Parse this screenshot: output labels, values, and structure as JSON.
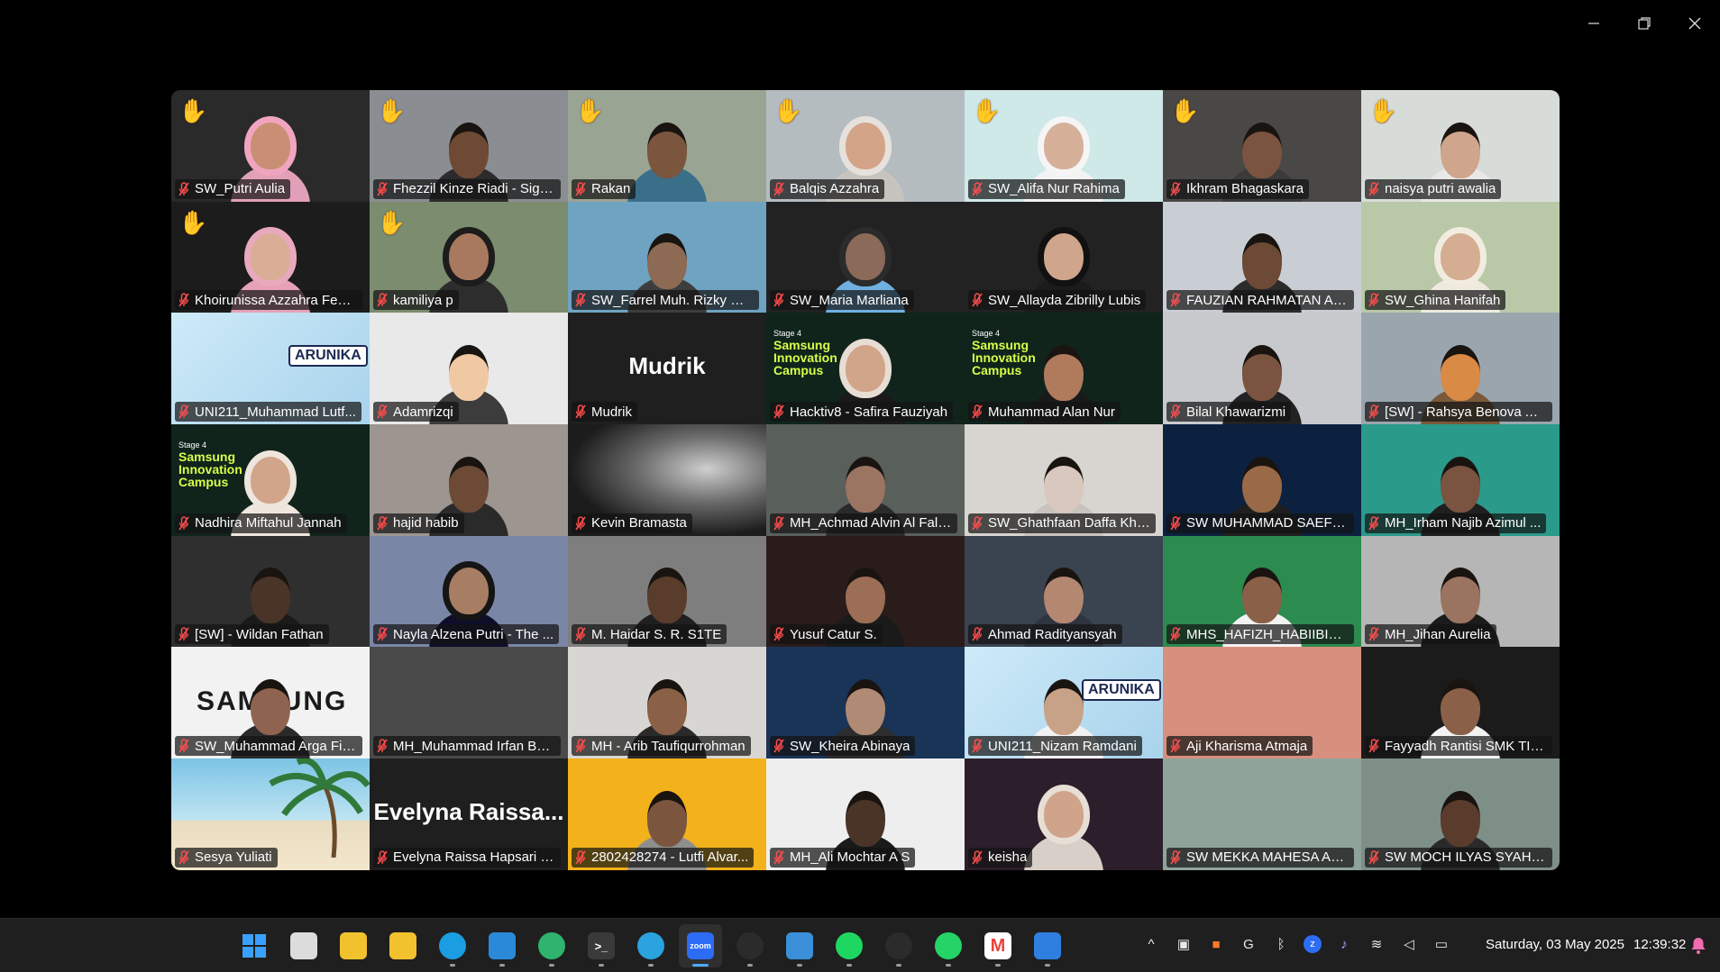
{
  "window": {
    "controls": [
      "minimize-icon",
      "restore-icon",
      "close-icon"
    ]
  },
  "participants": [
    {
      "name": "SW_Putri Aulia",
      "hand": true,
      "bg": "#2a2a2a",
      "skin": "#c98f74",
      "cloth": "#e2a0b8",
      "hijab": "#f1a4bf"
    },
    {
      "name": "Fhezzil Kinze Riadi - Sigm...",
      "hand": true,
      "bg": "#8a8d92",
      "skin": "#6e4a35",
      "cloth": "#2b2b2b"
    },
    {
      "name": "Rakan",
      "hand": true,
      "bg": "#9aa493",
      "skin": "#7b553e",
      "cloth": "#3a6f8a"
    },
    {
      "name": "Balqis Azzahra",
      "hand": true,
      "bg": "#b5bcc0",
      "skin": "#d3a488",
      "cloth": "#c7c3bf",
      "hijab": "#e6e1dc"
    },
    {
      "name": "SW_Alifa Nur Rahima",
      "hand": true,
      "bg": "#cfe8e8",
      "skin": "#d7b09a",
      "cloth": "#f3f3f3",
      "hijab": "#f5f5f5"
    },
    {
      "name": "Ikhram Bhagaskara",
      "hand": true,
      "bg": "#4a4747",
      "skin": "#7a5440",
      "cloth": "#3a3a3a"
    },
    {
      "name": "naisya putri awalia",
      "hand": true,
      "bg": "#d8dcd8",
      "skin": "#cfa58b",
      "cloth": "#e8e8e8"
    },
    {
      "name": "Khoirunissa Azzahra Febri...",
      "hand": true,
      "bg": "#1c1c1c",
      "skin": "#d9ad96",
      "cloth": "#e6a1b6",
      "hijab": "#e8a9bd"
    },
    {
      "name": "kamiliya p",
      "hand": true,
      "bg": "#7b8c6f",
      "skin": "#a8795e",
      "cloth": "#2d2d2d",
      "hijab": "#1c1c1c"
    },
    {
      "name": "SW_Farrel Muh. Rizky Wi...",
      "hand": false,
      "bg": "#6fa3c2",
      "skin": "#8d6a53",
      "cloth": "#3d3d3d"
    },
    {
      "name": "SW_Maria Marliana",
      "hand": false,
      "bg": "#222222",
      "skin": "#8b6a5a",
      "cloth": "#6fb0e0",
      "hijab": "#2b2b2b"
    },
    {
      "name": "SW_Allayda Zibrilly Lubis",
      "hand": false,
      "bg": "#222222",
      "skin": "#cfa58b",
      "cloth": "#1b1b1b",
      "hijab": "#111111"
    },
    {
      "name": "FAUZIAN RAHMATAN AN...",
      "hand": false,
      "bg": "#c9ced4",
      "skin": "#6d4a36",
      "cloth": "#2b2b2b"
    },
    {
      "name": "SW_Ghina Hanifah",
      "hand": false,
      "bg": "#b9c9a8",
      "skin": "#d4ad92",
      "cloth": "#efeae0",
      "hijab": "#f1ecdf"
    },
    {
      "name": "UNI211_Muhammad Lutf...",
      "hand": false,
      "bg": "#bfe1f3",
      "special": "arunika"
    },
    {
      "name": "Adamrizqi",
      "hand": false,
      "bg": "#e9e9e9",
      "skin": "#f0c9a4",
      "cloth": "#3c3c3c"
    },
    {
      "name": "Mudrik",
      "hand": false,
      "bg": "#1f1f1f",
      "special": "avatar",
      "big": "Mudrik"
    },
    {
      "name": "Hacktiv8 - Safira Fauziyah",
      "hand": false,
      "bg": "#10241c",
      "special": "slide",
      "active": true,
      "skin": "#d1a58a",
      "cloth": "#1a1a1a",
      "hijab": "#e7ddd3",
      "stage": "Stage 4",
      "title": "Samsung Innovation Campus"
    },
    {
      "name": "Muhammad Alan Nur",
      "hand": false,
      "bg": "#10241c",
      "special": "slide",
      "skin": "#b07b5c",
      "cloth": "#1a1a1a",
      "stage": "Stage 4",
      "title": "Samsung Innovation Campus"
    },
    {
      "name": "Bilal Khawarizmi",
      "hand": false,
      "bg": "#c7c9cc",
      "skin": "#7a5440",
      "cloth": "#222222"
    },
    {
      "name": "[SW] - Rahsya Benova Ak...",
      "hand": false,
      "bg": "#9aa5ae",
      "skin": "#d98a45",
      "cloth": "#7a5a3a"
    },
    {
      "name": "Nadhira Miftahul Jannah",
      "hand": false,
      "bg": "#10241c",
      "special": "slide",
      "skin": "#d1a58a",
      "cloth": "#efe7de",
      "hijab": "#eee5dc",
      "stage": "Stage 4",
      "title": "Samsung Innovation Campus"
    },
    {
      "name": "hajid habib",
      "hand": false,
      "bg": "#9d9690",
      "skin": "#6d4a36",
      "cloth": "#2a2a2a"
    },
    {
      "name": "Kevin Bramasta",
      "hand": false,
      "bg": "#4a4a4a",
      "special": "abstract"
    },
    {
      "name": "MH_Achmad Alvin Al Falah",
      "hand": false,
      "bg": "#595f5b",
      "skin": "#9c7462",
      "cloth": "#2a2a2a"
    },
    {
      "name": "SW_Ghathfaan Daffa Khai...",
      "hand": false,
      "bg": "#d8d4d0",
      "skin": "#d9c8bd",
      "cloth": "#c9c3bf"
    },
    {
      "name": "SW MUHAMMAD SAEFU...",
      "hand": false,
      "bg": "#0c2140",
      "skin": "#9a6a48",
      "cloth": "#1f1f1f"
    },
    {
      "name": "MH_Irham Najib Azimul ...",
      "hand": false,
      "bg": "#2a9a8a",
      "skin": "#7a5440",
      "cloth": "#1f1f1f"
    },
    {
      "name": "[SW] - Wildan Fathan",
      "hand": false,
      "bg": "#2f2f2f",
      "skin": "#4a3428",
      "cloth": "#1a1a1a"
    },
    {
      "name": "Nayla Alzena Putri - The ...",
      "hand": false,
      "bg": "#7a86a6",
      "skin": "#a77d64",
      "cloth": "#0e0e2a",
      "hijab": "#151515"
    },
    {
      "name": "M. Haidar S. R. S1TE",
      "hand": false,
      "bg": "#7e7e7e",
      "skin": "#5a3c2c",
      "cloth": "#1f1f1f"
    },
    {
      "name": "Yusuf Catur S.",
      "hand": false,
      "bg": "#2a1c1a",
      "skin": "#9c6e55",
      "cloth": "#1a1a1a"
    },
    {
      "name": "Ahmad Radityansyah",
      "hand": false,
      "bg": "#3a4350",
      "skin": "#b38770",
      "cloth": "#2e3440"
    },
    {
      "name": "MHS_HAFIZH_HABIIBI_LU...",
      "hand": false,
      "bg": "#2c8b4f",
      "skin": "#8a6148",
      "cloth": "#f2f2f2"
    },
    {
      "name": "MH_Jihan Aurelia",
      "hand": false,
      "bg": "#b6b6b6",
      "skin": "#9a7460",
      "cloth": "#1b1b1b",
      "pinkbar": true
    },
    {
      "name": "SW_Muhammad Arga Fik...",
      "hand": false,
      "bg": "#f2f2f2",
      "special": "samsung",
      "skin": "#8e6450",
      "cloth": "#2a2a2a",
      "logo": "SAMSUNG"
    },
    {
      "name": "MH_Muhammad Irfan Bai...",
      "hand": false,
      "bg": "#4a4a4a",
      "special": "blank"
    },
    {
      "name": "MH - Arib Taufiqurrohman",
      "hand": false,
      "bg": "#d8d6d2",
      "skin": "#8a6046",
      "cloth": "#2a2a2a"
    },
    {
      "name": "SW_Kheira Abinaya",
      "hand": false,
      "bg": "#1a3458",
      "skin": "#b08a75",
      "cloth": "#2d2d2d"
    },
    {
      "name": "UNI211_Nizam Ramdani",
      "hand": false,
      "bg": "#bfe1f3",
      "special": "arunika",
      "skin": "#c8a287",
      "cloth": "#f2f2f2"
    },
    {
      "name": "Aji Kharisma Atmaja",
      "hand": false,
      "bg": "#d8907e",
      "special": "blank"
    },
    {
      "name": "Fayyadh Rantisi SMK TI B...",
      "hand": false,
      "bg": "#1b1b1b",
      "skin": "#8a6148",
      "cloth": "#f3f3f3"
    },
    {
      "name": "Sesya Yuliati",
      "hand": false,
      "bg": "#6fb7d6",
      "special": "beach"
    },
    {
      "name": "Evelyna Raissa Hapsari SW",
      "hand": false,
      "bg": "#1f1f1f",
      "special": "avatar",
      "big": "Evelyna  Raissa..."
    },
    {
      "name": "2802428274 - Lutfi Alvar...",
      "hand": false,
      "bg": "#f3b21b",
      "skin": "#7b553e",
      "cloth": "#8e8e8e"
    },
    {
      "name": "MH_Ali Mochtar A S",
      "hand": false,
      "bg": "#eeeeee",
      "skin": "#4a3428",
      "cloth": "#1a1a1a"
    },
    {
      "name": "keisha",
      "hand": false,
      "bg": "#2c1e2a",
      "skin": "#cfa48a",
      "cloth": "#d8d0c8",
      "hijab": "#e7ded6"
    },
    {
      "name": "SW MEKKA MAHESA ALB...",
      "hand": false,
      "bg": "#8fa39a",
      "special": "blank"
    },
    {
      "name": "SW MOCH ILYAS SYAHM...",
      "hand": false,
      "bg": "#7e8f88",
      "skin": "#5a3c2c",
      "cloth": "#2a2a2a"
    }
  ],
  "taskbar": {
    "apps": [
      {
        "icon": "windows-start-icon",
        "color": "#3aa0ff",
        "glyph": "",
        "running": false
      },
      {
        "icon": "task-view-icon",
        "color": "#dcdcdc",
        "glyph": "",
        "running": false
      },
      {
        "icon": "lock-app-icon",
        "color": "#f2c12e",
        "glyph": "",
        "running": false
      },
      {
        "icon": "file-explorer-icon",
        "color": "#f2c12e",
        "glyph": "",
        "running": false
      },
      {
        "icon": "edge-browser-icon",
        "color": "#1b9de2",
        "glyph": "",
        "running": true
      },
      {
        "icon": "vscode-icon",
        "color": "#2a8ad8",
        "glyph": "",
        "running": true
      },
      {
        "icon": "edge-profile-icon",
        "color": "#2fb36f",
        "glyph": "",
        "running": true
      },
      {
        "icon": "terminal-icon",
        "color": "#3a3a3a",
        "glyph": ">_",
        "running": true
      },
      {
        "icon": "telegram-icon",
        "color": "#2aa3df",
        "glyph": "",
        "running": true
      },
      {
        "icon": "zoom-icon",
        "color": "#2d6cf5",
        "glyph": "zoom",
        "running": true,
        "active": true
      },
      {
        "icon": "obs-icon",
        "color": "#2b2b2b",
        "glyph": "",
        "running": true
      },
      {
        "icon": "photos-icon",
        "color": "#3a8fd8",
        "glyph": "",
        "running": true
      },
      {
        "icon": "spotify-icon",
        "color": "#1ed760",
        "glyph": "",
        "running": true
      },
      {
        "icon": "chatgpt-icon",
        "color": "#2b2b2b",
        "glyph": "",
        "running": true
      },
      {
        "icon": "whatsapp-icon",
        "color": "#25d366",
        "glyph": "",
        "running": true
      },
      {
        "icon": "gmail-icon",
        "color": "#ffffff",
        "glyph": "M",
        "running": true
      },
      {
        "icon": "drawing-app-icon",
        "color": "#2f7fe0",
        "glyph": "",
        "running": true
      }
    ],
    "tray": [
      {
        "icon": "chevron-up-icon",
        "glyph": "^"
      },
      {
        "icon": "tray-app-icon",
        "glyph": "▣"
      },
      {
        "icon": "tray-orange-icon",
        "glyph": "■"
      },
      {
        "icon": "g-icon",
        "glyph": "G"
      },
      {
        "icon": "bluetooth-icon",
        "glyph": "ᛒ"
      },
      {
        "icon": "zoom-tray-icon",
        "glyph": "z"
      },
      {
        "icon": "mic-tray-icon",
        "glyph": "♪"
      },
      {
        "icon": "wifi-icon",
        "glyph": "≋"
      },
      {
        "icon": "volume-icon",
        "glyph": "◁"
      },
      {
        "icon": "battery-icon",
        "glyph": "▭"
      }
    ],
    "date": "Saturday, 03 May 2025",
    "time": "12:39:32"
  }
}
